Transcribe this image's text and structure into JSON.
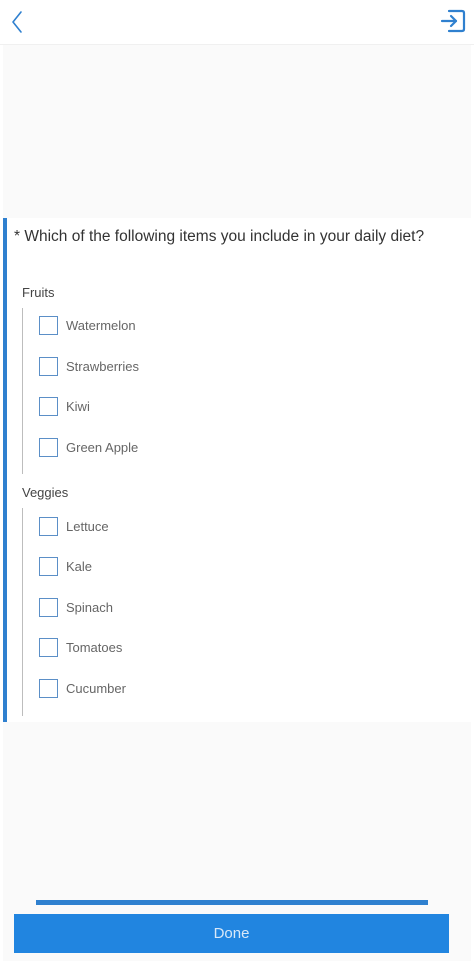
{
  "header": {
    "back_icon": "chevron-left-icon",
    "exit_icon": "sign-out-icon",
    "accent_color": "#2f80cf"
  },
  "question": {
    "text": "* Which of the following items you include in your daily diet?",
    "groups": [
      {
        "title": "Fruits",
        "options": [
          "Watermelon",
          "Strawberries",
          "Kiwi",
          "Green Apple"
        ]
      },
      {
        "title": "Veggies",
        "options": [
          "Lettuce",
          "Kale",
          "Spinach",
          "Tomatoes",
          "Cucumber"
        ]
      }
    ]
  },
  "footer": {
    "done_label": "Done",
    "button_color": "#2185e0"
  }
}
